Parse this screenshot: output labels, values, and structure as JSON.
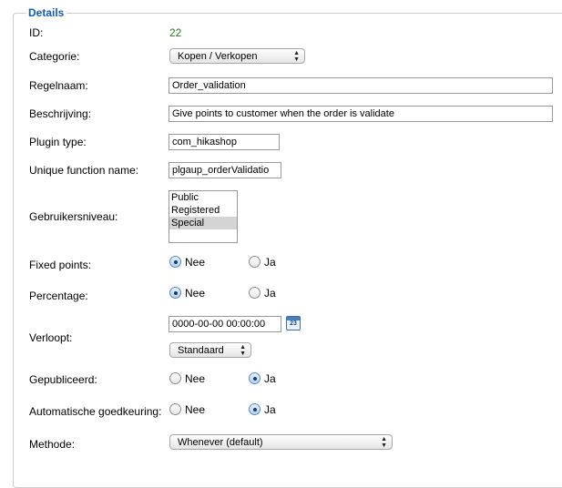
{
  "legend": "Details",
  "fields": {
    "id": {
      "label": "ID:",
      "value": "22"
    },
    "categorie": {
      "label": "Categorie:",
      "value": "Kopen / Verkopen"
    },
    "regelnaam": {
      "label": "Regelnaam:",
      "value": "Order_validation"
    },
    "beschrijving": {
      "label": "Beschrijving:",
      "value": "Give points to customer when the order is validate"
    },
    "plugin_type": {
      "label": "Plugin type:",
      "value": "com_hikashop"
    },
    "unique_function_name": {
      "label": "Unique function name:",
      "value": "plgaup_orderValidatio"
    },
    "gebruikersniveau": {
      "label": "Gebruikersniveau:",
      "options": [
        "Public",
        "Registered",
        "Special"
      ],
      "selected": "Special"
    },
    "fixed_points": {
      "label": "Fixed points:",
      "no": "Nee",
      "yes": "Ja",
      "selected": "Nee"
    },
    "percentage": {
      "label": "Percentage:",
      "no": "Nee",
      "yes": "Ja",
      "selected": "Nee"
    },
    "verloopt": {
      "label": "Verloopt:",
      "value": "0000-00-00 00:00:00",
      "calendar_day": "23",
      "mode": "Standaard"
    },
    "gepubliceerd": {
      "label": "Gepubliceerd:",
      "no": "Nee",
      "yes": "Ja",
      "selected": "Ja"
    },
    "automatische_goedkeuring": {
      "label": "Automatische goedkeuring:",
      "no": "Nee",
      "yes": "Ja",
      "selected": "Ja"
    },
    "methode": {
      "label": "Methode:",
      "value": "Whenever (default)"
    }
  },
  "icons": {
    "select_arrows": "updown-arrows-icon",
    "calendar": "calendar-icon"
  },
  "colors": {
    "legend": "#135cae",
    "id_value": "#2a7a2a"
  }
}
